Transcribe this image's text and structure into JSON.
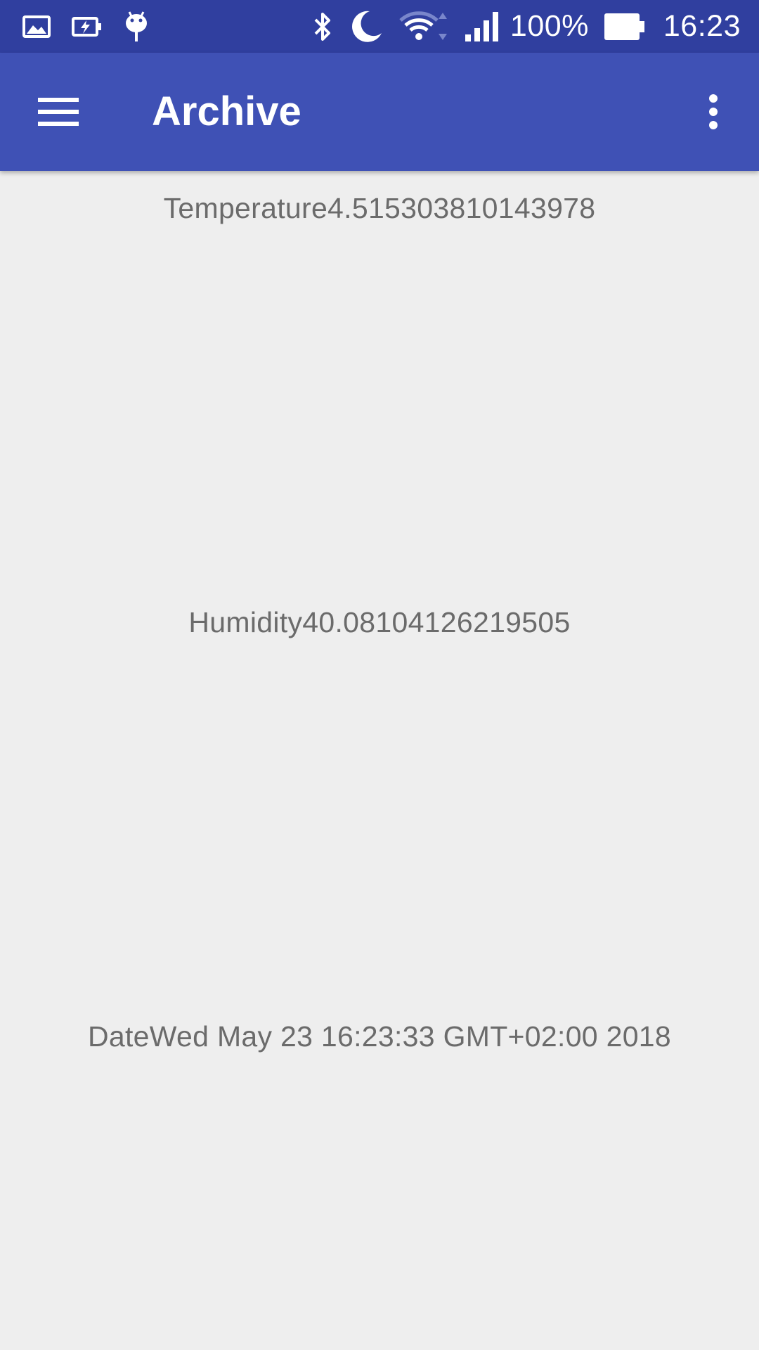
{
  "status_bar": {
    "left_icons": [
      "gallery-icon",
      "battery-saver-icon",
      "android-debug-icon"
    ],
    "right_icons": [
      "bluetooth-icon",
      "do-not-disturb-moon-icon",
      "wifi-icon",
      "cellular-signal-icon",
      "battery-icon"
    ],
    "battery_percent": "100%",
    "time": "16:23"
  },
  "app_bar": {
    "title": "Archive",
    "nav_icon": "hamburger-menu-icon",
    "overflow_icon": "more-vert-icon"
  },
  "records": {
    "temperature": "Temperature4.515303810143978",
    "humidity": "Humidity40.08104126219505",
    "date": "DateWed May 23 16:23:33 GMT+02:00 2018"
  },
  "colors": {
    "status_bar": "#303f9f",
    "app_bar": "#3f51b5",
    "background": "#eeeeee",
    "text": "#6b6b6b"
  }
}
